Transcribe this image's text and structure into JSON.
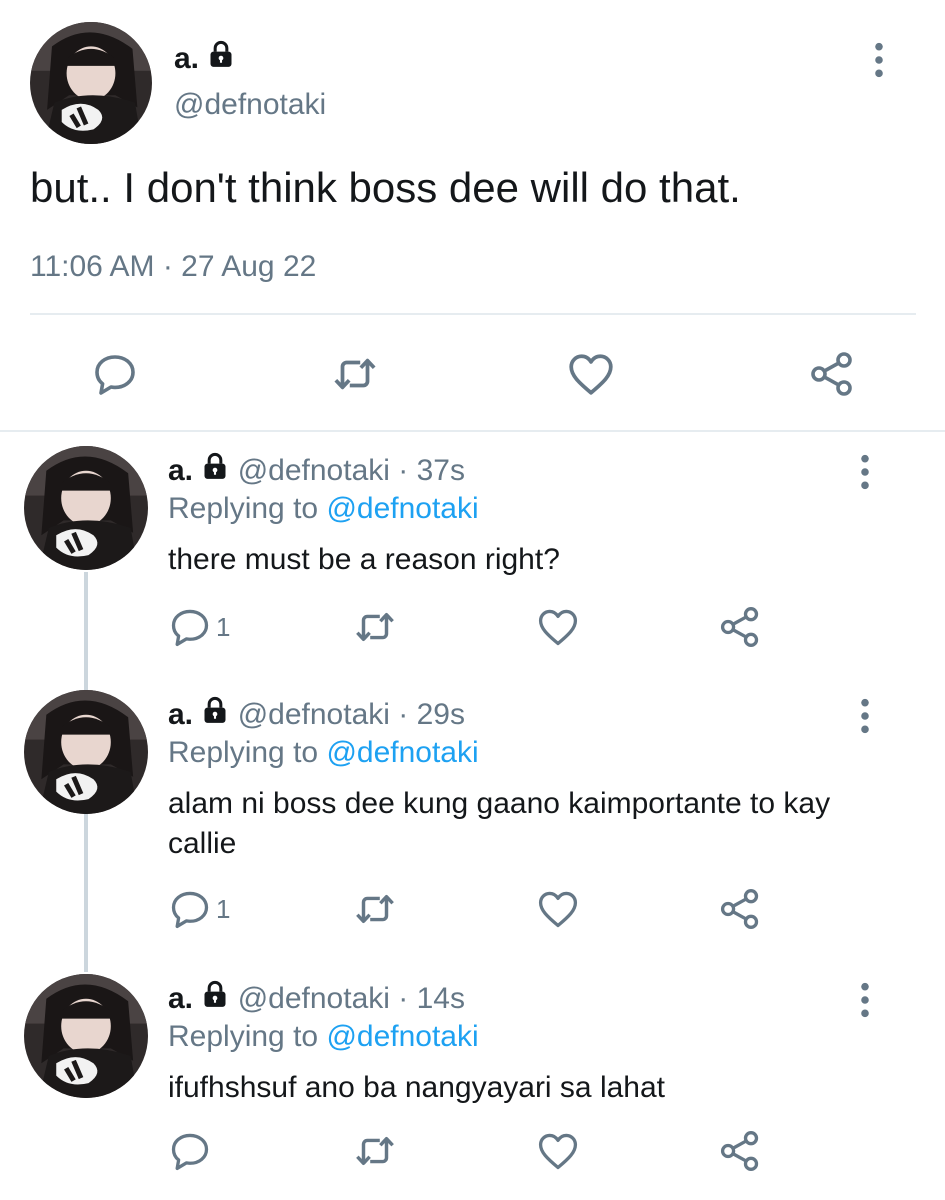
{
  "main_tweet": {
    "display_name": "a.",
    "handle": "@defnotaki",
    "text": "but.. I don't think boss dee will do that.",
    "timestamp": "11:06 AM · 27 Aug 22",
    "icons": {
      "lock": "lock-icon",
      "more": "more-vertical-icon",
      "reply": "reply-icon",
      "retweet": "retweet-icon",
      "like": "heart-icon",
      "share": "share-icon"
    }
  },
  "replies": [
    {
      "display_name": "a.",
      "handle": "@defnotaki",
      "separator": "·",
      "time": "37s",
      "replying_prefix": "Replying to",
      "replying_to": "@defnotaki",
      "text": "there must be a reason right?",
      "reply_count": "1"
    },
    {
      "display_name": "a.",
      "handle": "@defnotaki",
      "separator": "·",
      "time": "29s",
      "replying_prefix": "Replying to",
      "replying_to": "@defnotaki",
      "text": "alam ni boss dee kung gaano kaimportante to kay callie",
      "reply_count": "1"
    },
    {
      "display_name": "a.",
      "handle": "@defnotaki",
      "separator": "·",
      "time": "14s",
      "replying_prefix": "Replying to",
      "replying_to": "@defnotaki",
      "text": "ifufhshsuf ano ba nangyayari sa lahat",
      "reply_count": ""
    }
  ],
  "colors": {
    "text_primary": "#14171a",
    "text_secondary": "#657786",
    "link": "#1da1f2",
    "divider": "#e6ecf0",
    "thread_line": "#ccd6dd"
  }
}
